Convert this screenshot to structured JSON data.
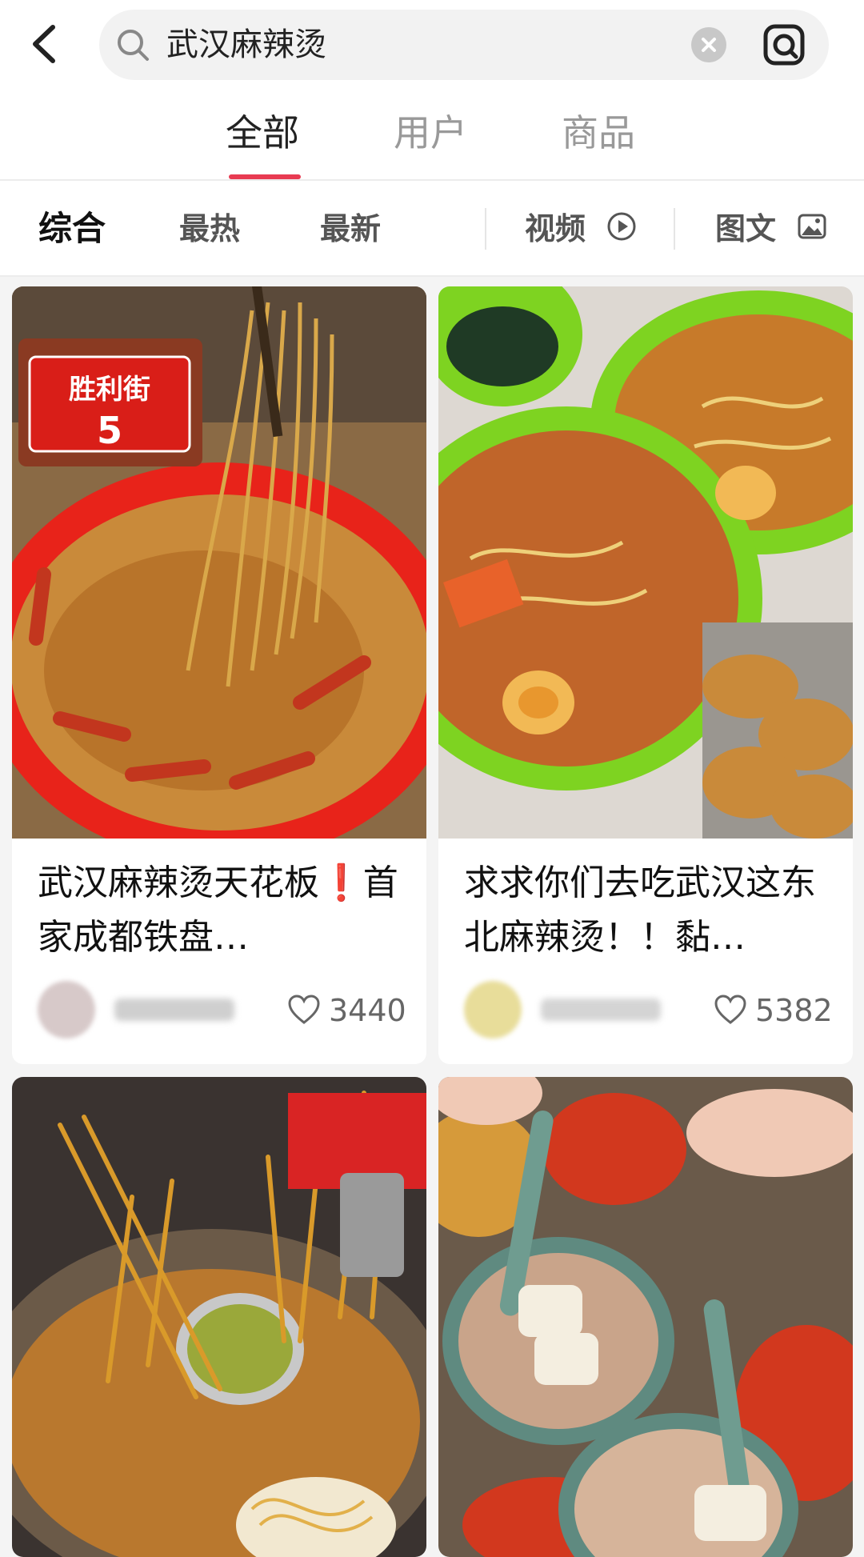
{
  "search": {
    "query": "武汉麻辣烫"
  },
  "tabs": [
    {
      "label": "全部",
      "active": true
    },
    {
      "label": "用户",
      "active": false
    },
    {
      "label": "商品",
      "active": false
    }
  ],
  "filters": [
    {
      "label": "综合",
      "active": true
    },
    {
      "label": "最热"
    },
    {
      "label": "最新"
    },
    {
      "label": "视频",
      "icon": "play-icon"
    },
    {
      "label": "图文",
      "icon": "image-icon"
    }
  ],
  "cards": [
    {
      "title": "武汉麻辣烫天花板❗️首家成都铁盘…",
      "likes": "3440",
      "image_sign": {
        "line1": "胜利街",
        "line2": "5"
      }
    },
    {
      "title": "求求你们去吃武汉这东北麻辣烫！！黏…",
      "likes": "5382"
    },
    {
      "title": "",
      "likes": ""
    },
    {
      "title": "",
      "likes": ""
    }
  ],
  "colors": {
    "accent": "#e83b52",
    "bowl_green": "#7ed321",
    "plate_red": "#e8231a"
  }
}
